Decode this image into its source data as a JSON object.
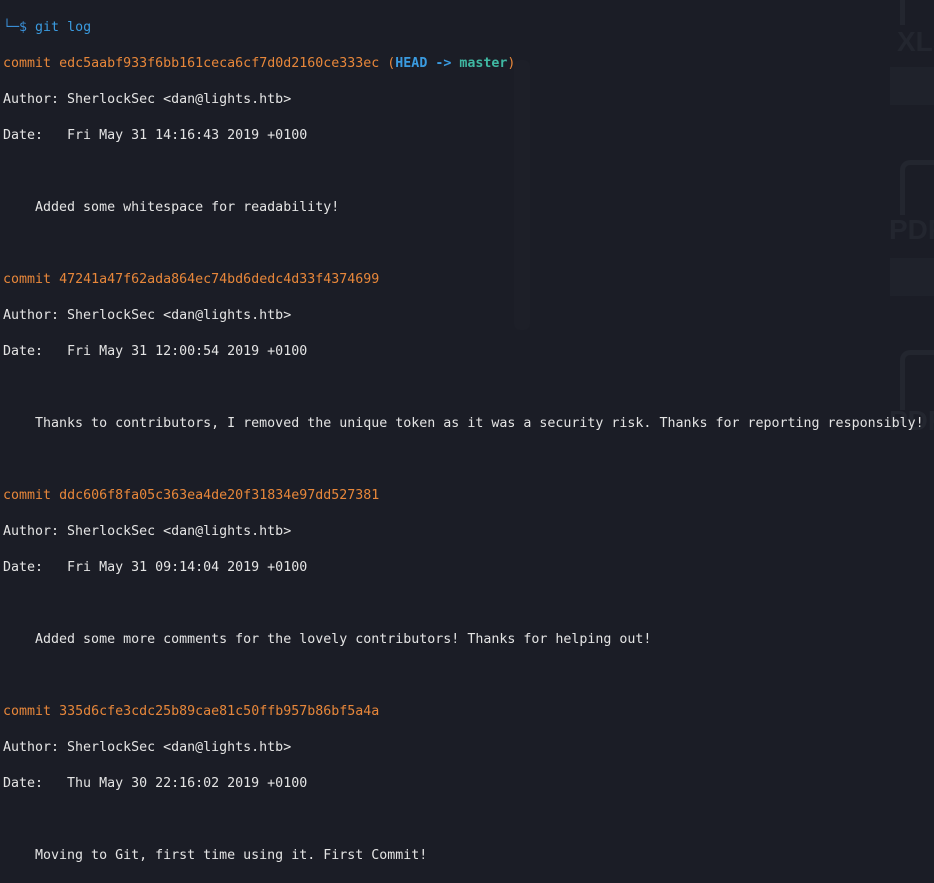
{
  "prompt": {
    "symbol": "└─$",
    "command": "git log"
  },
  "commits": [
    {
      "label": "commit",
      "hash": "edc5aabf933f6bb161ceca6cf7d0d2160ce333ec",
      "refs": {
        "open": " (",
        "head": "HEAD",
        "arrow": " -> ",
        "branch": "master",
        "close": ")"
      },
      "author": "Author: SherlockSec <dan@lights.htb>",
      "date": "Date:   Fri May 31 14:16:43 2019 +0100",
      "message": "    Added some whitespace for readability!"
    },
    {
      "label": "commit",
      "hash": "47241a47f62ada864ec74bd6dedc4d33f4374699",
      "author": "Author: SherlockSec <dan@lights.htb>",
      "date": "Date:   Fri May 31 12:00:54 2019 +0100",
      "message": "    Thanks to contributors, I removed the unique token as it was a security risk. Thanks for reporting responsibly!"
    },
    {
      "label": "commit",
      "hash": "ddc606f8fa05c363ea4de20f31834e97dd527381",
      "author": "Author: SherlockSec <dan@lights.htb>",
      "date": "Date:   Fri May 31 09:14:04 2019 +0100",
      "message": "    Added some more comments for the lovely contributors! Thanks for helping out!"
    },
    {
      "label": "commit",
      "hash": "335d6cfe3cdc25b89cae81c50ffb957b86bf5a4a",
      "author": "Author: SherlockSec <dan@lights.htb>",
      "date": "Date:   Thu May 30 22:16:02 2019 +0100",
      "message": "    Moving to Git, first time using it. First Commit!"
    }
  ],
  "watermarks": [
    "XLS",
    "PDF",
    "PDF"
  ],
  "colors": {
    "background": "#1b1d26",
    "commit": "#e8873a",
    "head": "#3a9be0",
    "branch": "#3fb8a2"
  }
}
